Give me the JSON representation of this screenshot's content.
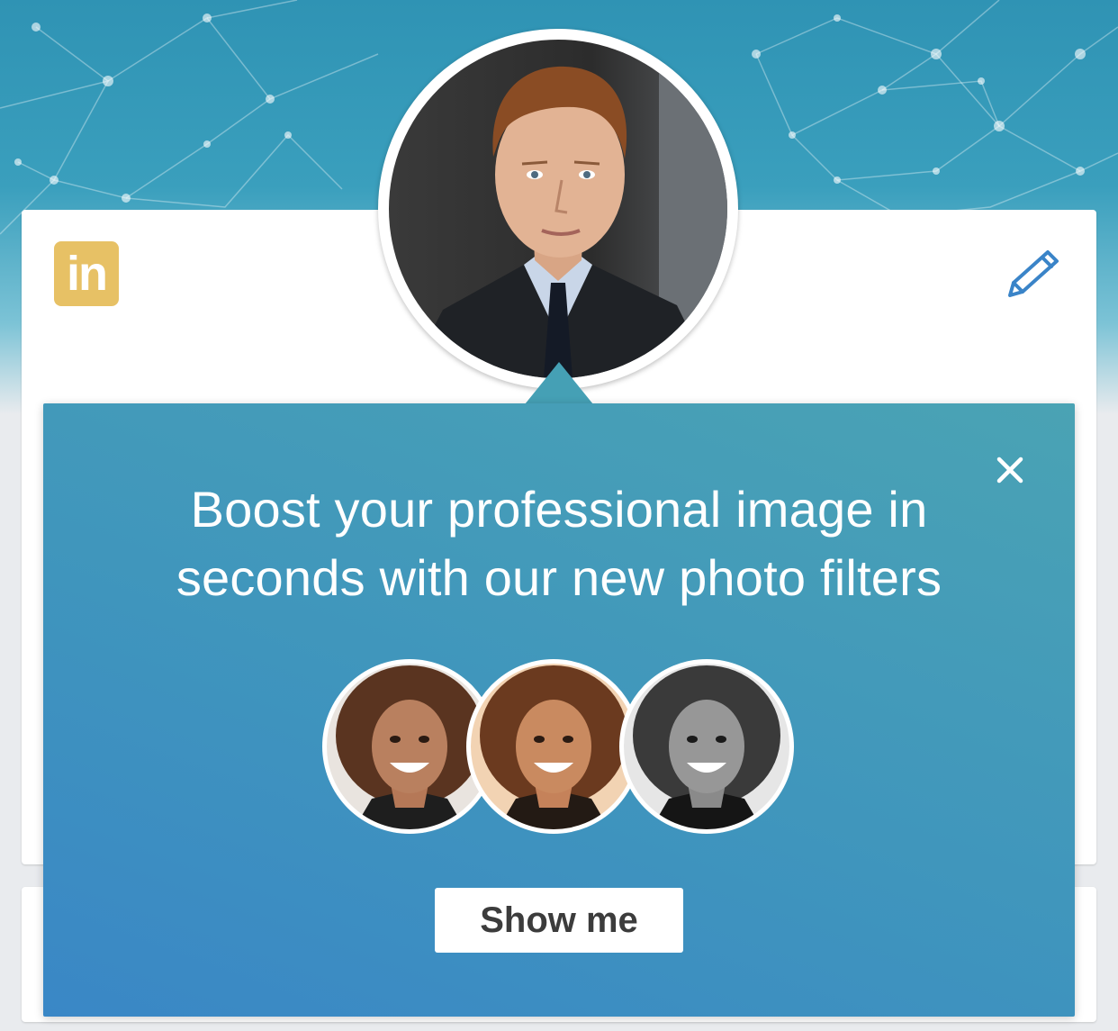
{
  "app": {
    "brand_badge": "in"
  },
  "popup": {
    "headline_line1": "Boost your professional image in",
    "headline_line2": "seconds with our new photo filters",
    "show_me_label": "Show me"
  },
  "icons": {
    "brand": "linkedin-logo-icon",
    "edit": "pencil-icon",
    "close": "close-icon"
  },
  "colors": {
    "brand_badge": "#e7c165",
    "popup_top": "#4aa3b4",
    "popup_bottom": "#3a87c6",
    "edit_icon": "#3a84c8"
  }
}
